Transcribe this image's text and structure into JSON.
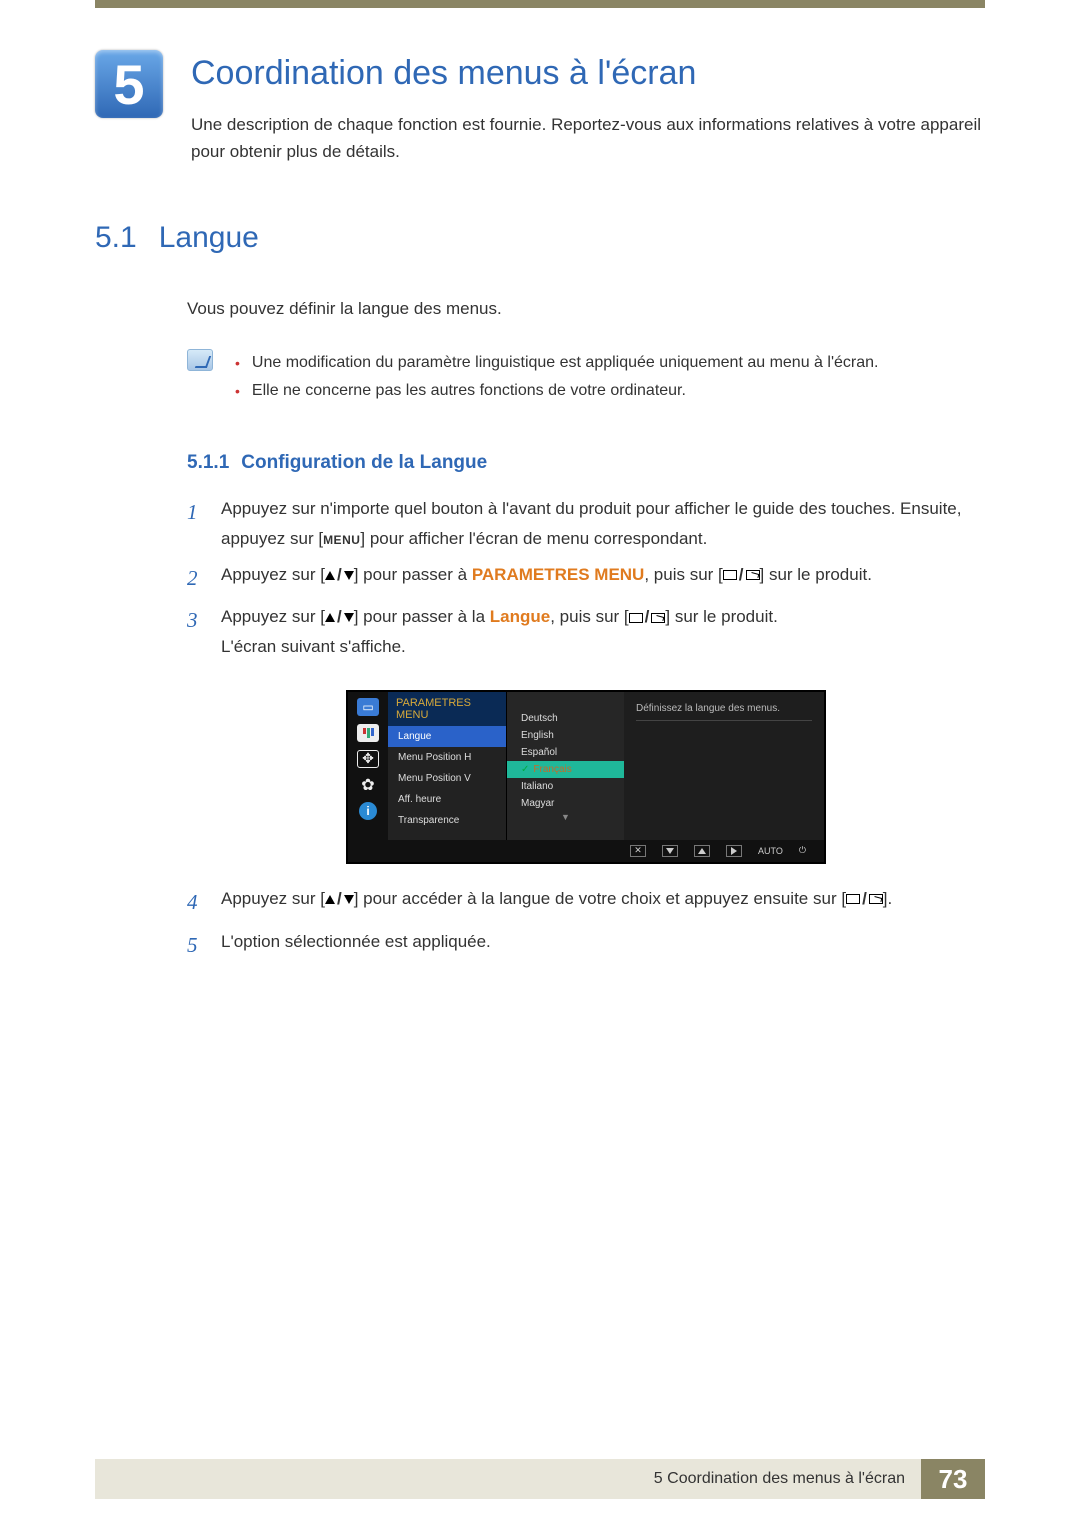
{
  "chapter": {
    "number": "5",
    "title": "Coordination des menus à l'écran",
    "description": "Une description de chaque fonction est fournie. Reportez-vous aux informations relatives à votre appareil pour obtenir plus de détails."
  },
  "section": {
    "number": "5.1",
    "title": "Langue",
    "intro": "Vous pouvez définir la langue des menus.",
    "notes": [
      "Une modification du paramètre linguistique est appliquée uniquement au menu à l'écran.",
      "Elle ne concerne pas les autres fonctions de votre ordinateur."
    ]
  },
  "subsection": {
    "number": "5.1.1",
    "title": "Configuration de la Langue"
  },
  "steps": {
    "s1a": "Appuyez sur n'importe quel bouton à l'avant du produit pour afficher le guide des touches. Ensuite, appuyez sur [",
    "s1b": "] pour afficher l'écran de menu correspondant.",
    "menu_label": "MENU",
    "s2a": "Appuyez sur [",
    "s2b": "] pour passer à ",
    "s2_target": "PARAMETRES MENU",
    "s2c": ", puis sur [",
    "s2d": "] sur le produit.",
    "s3a": "Appuyez sur [",
    "s3b": "] pour passer à la ",
    "s3_target": "Langue",
    "s3c": ", puis sur [",
    "s3d": "] sur le produit.",
    "s3e": "L'écran suivant s'affiche.",
    "s4a": "Appuyez sur [",
    "s4b": "] pour accéder à la langue de votre choix et appuyez ensuite sur [",
    "s4c": "].",
    "s5": "L'option sélectionnée est appliquée."
  },
  "osd": {
    "title": "PARAMETRES MENU",
    "menu_items": [
      "Langue",
      "Menu Position H",
      "Menu Position V",
      "Aff. heure",
      "Transparence"
    ],
    "options": [
      "Deutsch",
      "English",
      "Español",
      "Français",
      "Italiano",
      "Magyar"
    ],
    "selected_option_index": 3,
    "description": "Définissez la langue des menus.",
    "bottom_auto": "AUTO"
  },
  "footer": {
    "text": "5 Coordination des menus à l'écran",
    "page": "73"
  }
}
